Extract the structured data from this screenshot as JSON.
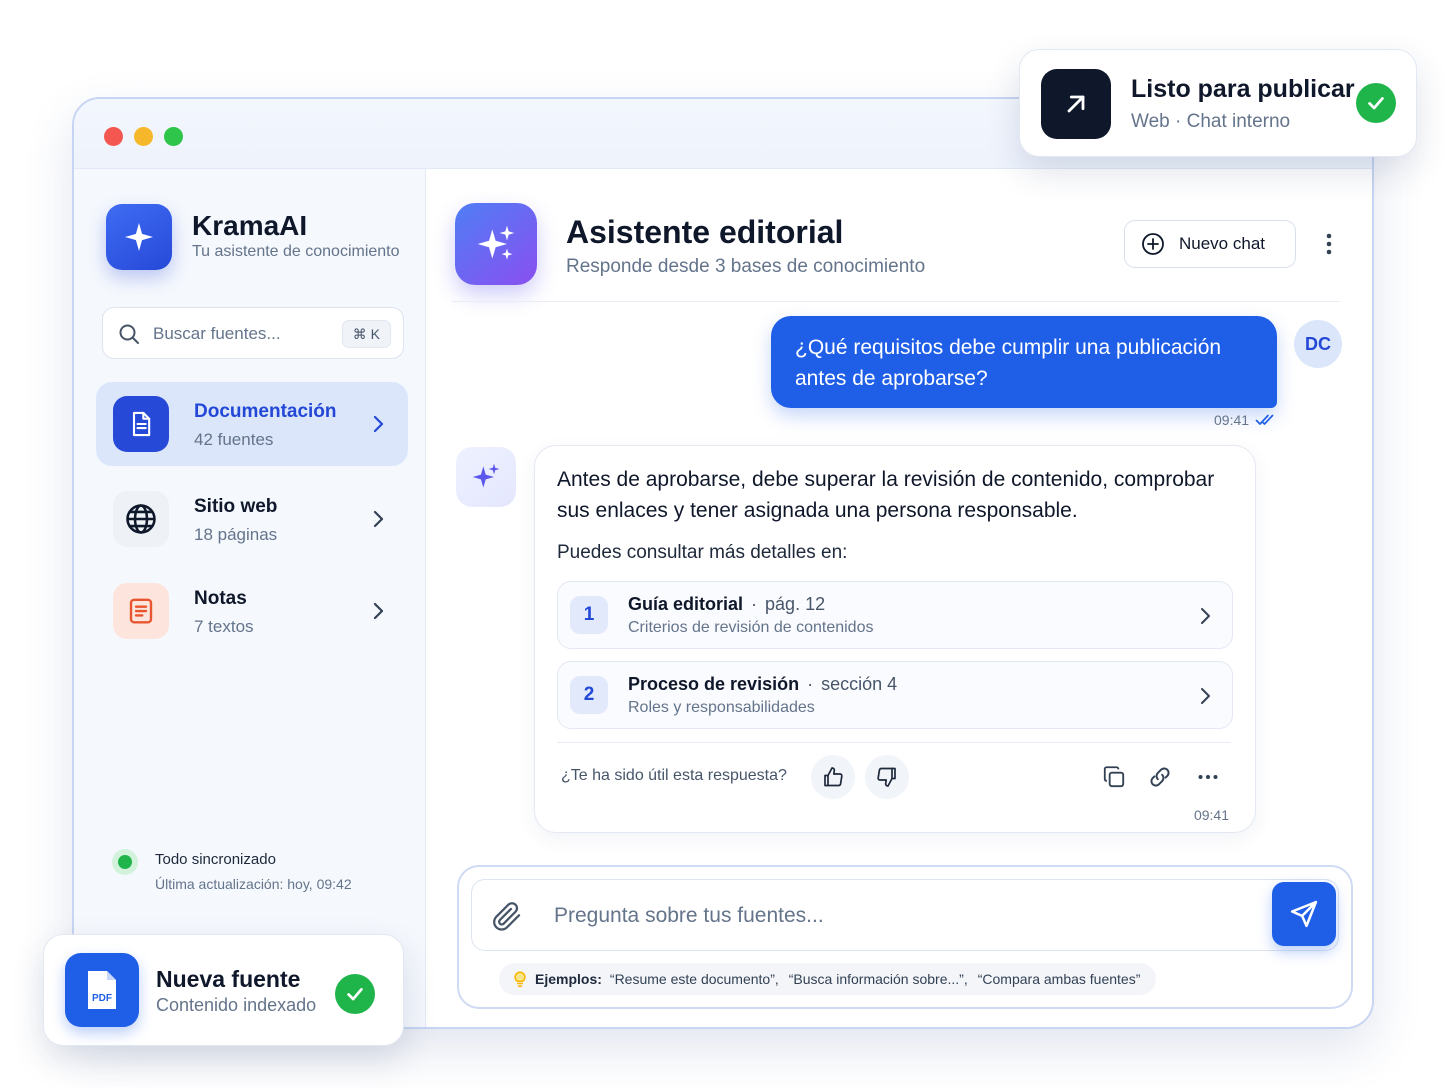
{
  "brand": {
    "name": "KramaAI",
    "tagline": "Tu asistente de conocimiento"
  },
  "search": {
    "placeholder": "Buscar fuentes...",
    "shortcut": "⌘ K"
  },
  "sources": [
    {
      "title": "Documentación",
      "subtitle": "42 fuentes",
      "icon": "document-icon",
      "active": true
    },
    {
      "title": "Sitio web",
      "subtitle": "18 páginas",
      "icon": "globe-icon",
      "active": false
    },
    {
      "title": "Notas",
      "subtitle": "7 textos",
      "icon": "notes-icon",
      "active": false
    }
  ],
  "sync": {
    "status": "Todo sincronizado",
    "last_update": "Última actualización: hoy, 09:42"
  },
  "chat_header": {
    "title": "Asistente editorial",
    "subtitle": "Responde desde 3 bases de conocimiento",
    "new_chat_label": "Nuevo chat"
  },
  "user_message": {
    "avatar": "DC",
    "text": "¿Qué requisitos debe cumplir una publicación antes de aprobarse?",
    "time": "09:41"
  },
  "bot_message": {
    "text": "Antes de aprobarse, debe superar la revisión de contenido, comprobar sus enlaces y tener asignada una persona responsable.",
    "more": "Puedes consultar más detalles en:",
    "references": [
      {
        "num": "1",
        "title": "Guía editorial",
        "separator": "·",
        "location": "pág. 12",
        "subtitle": "Criterios de revisión de contenidos"
      },
      {
        "num": "2",
        "title": "Proceso de revisión",
        "separator": "·",
        "location": "sección 4",
        "subtitle": "Roles y responsabilidades"
      }
    ],
    "feedback_question": "¿Te ha sido útil esta respuesta?",
    "time": "09:41"
  },
  "composer": {
    "placeholder": "Pregunta sobre tus fuentes...",
    "examples_label": "Ejemplos:",
    "examples": [
      "“Resume este documento”,",
      "“Busca información sobre...”,",
      "“Compara ambas fuentes”"
    ]
  },
  "toast_publish": {
    "title": "Listo para publicar",
    "subtitle": "Web · Chat interno"
  },
  "toast_source": {
    "title": "Nueva fuente",
    "subtitle": "Contenido indexado",
    "file_badge": "PDF"
  },
  "colors": {
    "primary": "#1f5fe8",
    "brand": "#2649d8",
    "success": "#1fb54a",
    "active_bg": "#dbe6fb"
  }
}
